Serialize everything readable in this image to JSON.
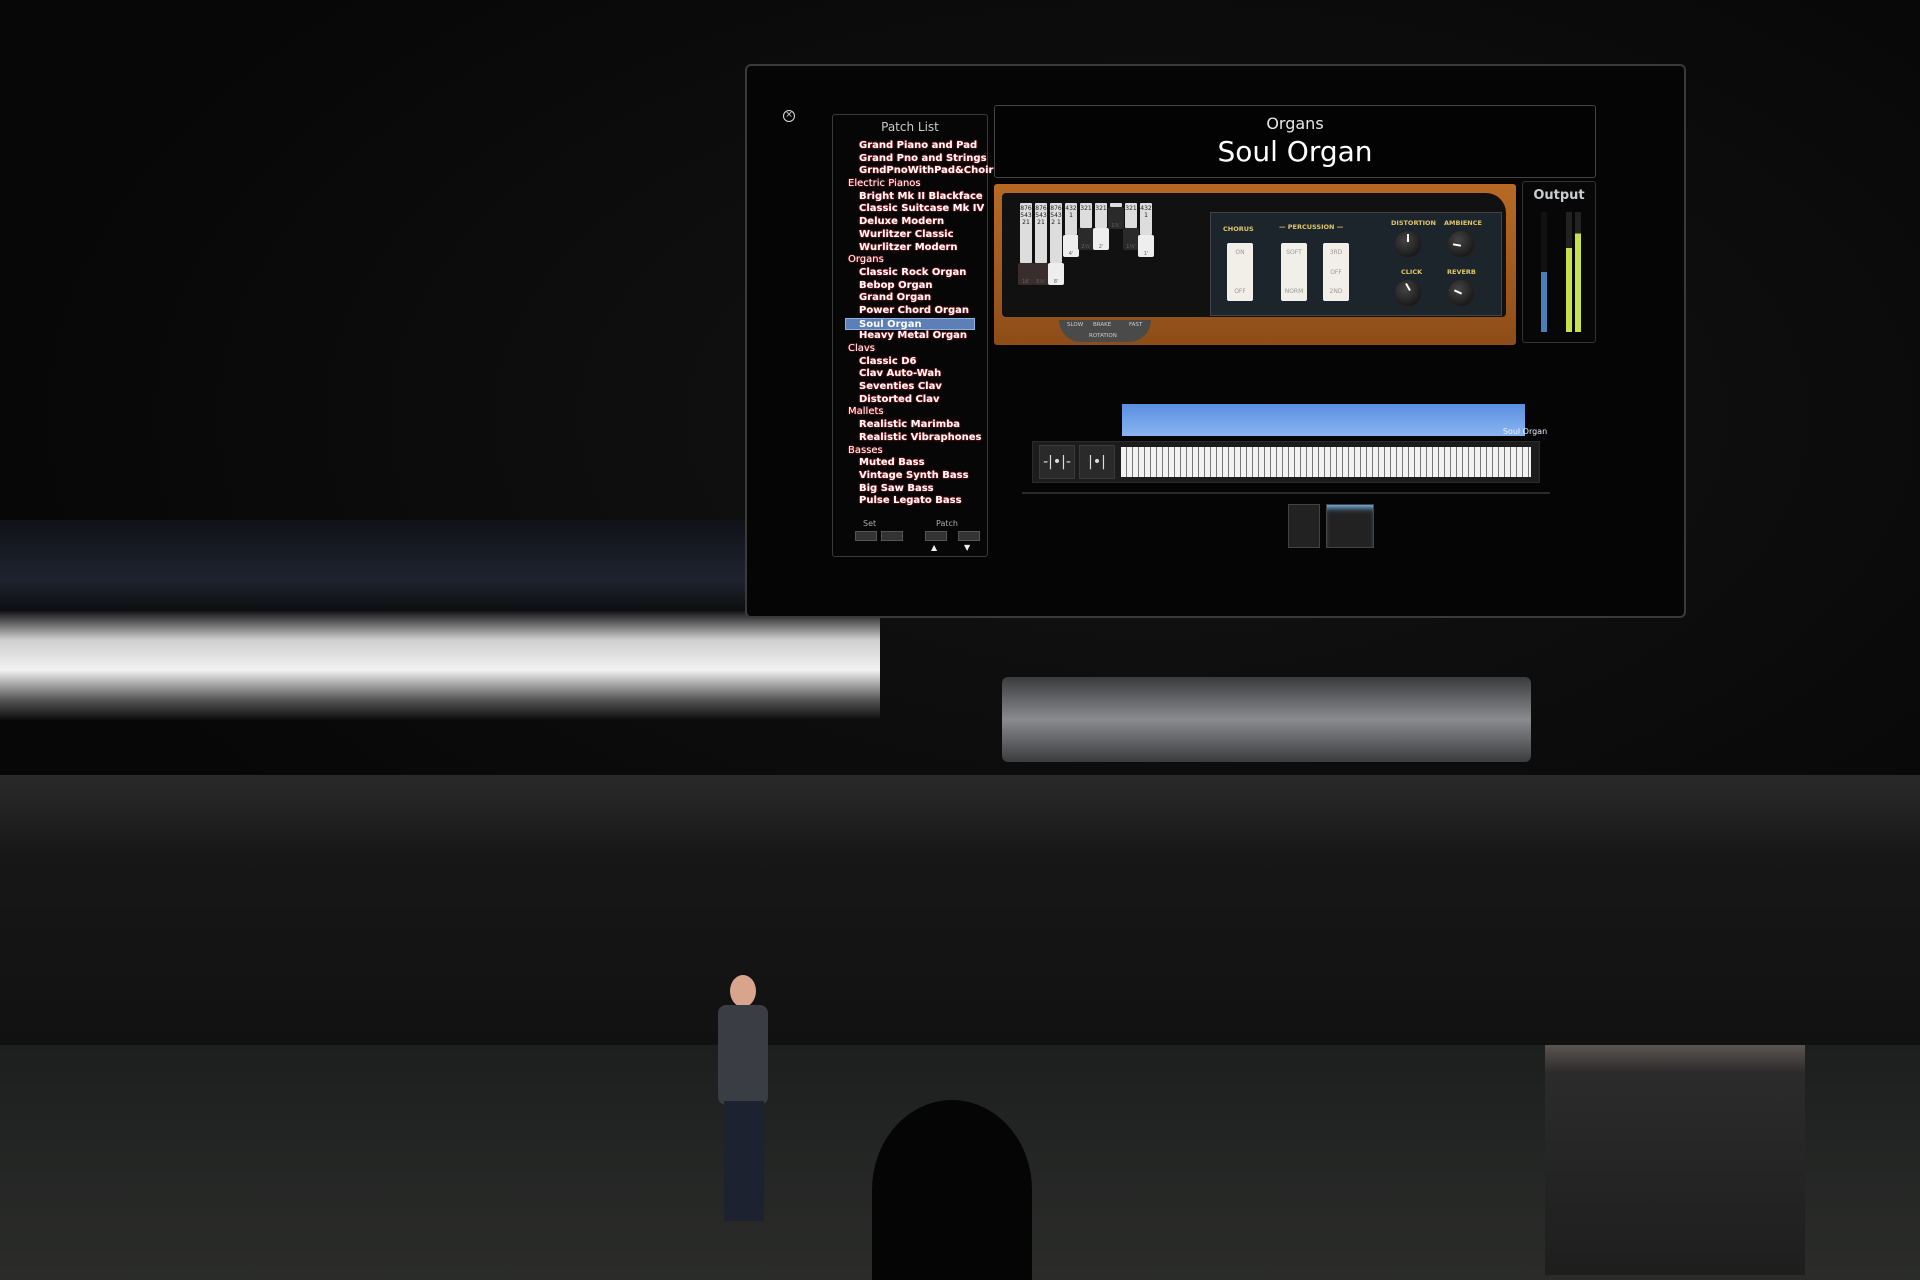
{
  "screen": {
    "close_icon": "close-circle-icon",
    "patch_list": {
      "title": "Patch List",
      "rows": [
        {
          "type": "item",
          "label": "Grand Piano and Pad"
        },
        {
          "type": "item",
          "label": "Grand Pno and Strings"
        },
        {
          "type": "item",
          "label": "GrndPnoWithPad&Choir"
        },
        {
          "type": "category",
          "label": "Electric Pianos"
        },
        {
          "type": "item",
          "label": "Bright Mk II Blackface"
        },
        {
          "type": "item",
          "label": "Classic Suitcase Mk IV"
        },
        {
          "type": "item",
          "label": "Deluxe Modern"
        },
        {
          "type": "item",
          "label": "Wurlitzer Classic"
        },
        {
          "type": "item",
          "label": "Wurlitzer Modern"
        },
        {
          "type": "category",
          "label": "Organs"
        },
        {
          "type": "item",
          "label": "Classic Rock Organ"
        },
        {
          "type": "item",
          "label": "Bebop Organ"
        },
        {
          "type": "item",
          "label": "Grand Organ"
        },
        {
          "type": "item",
          "label": "Power Chord Organ"
        },
        {
          "type": "item",
          "label": "Soul Organ",
          "selected": true
        },
        {
          "type": "item",
          "label": "Heavy Metal Organ"
        },
        {
          "type": "category",
          "label": "Clavs"
        },
        {
          "type": "item",
          "label": "Classic D6"
        },
        {
          "type": "item",
          "label": "Clav Auto-Wah"
        },
        {
          "type": "item",
          "label": "Seventies Clav"
        },
        {
          "type": "item",
          "label": "Distorted Clav"
        },
        {
          "type": "category",
          "label": "Mallets"
        },
        {
          "type": "item",
          "label": "Realistic Marimba"
        },
        {
          "type": "item",
          "label": "Realistic Vibraphones"
        },
        {
          "type": "category",
          "label": "Basses"
        },
        {
          "type": "item",
          "label": "Muted Bass"
        },
        {
          "type": "item",
          "label": "Vintage Synth Bass"
        },
        {
          "type": "item",
          "label": "Big Saw Bass"
        },
        {
          "type": "item",
          "label": "Pulse Legato Bass"
        }
      ],
      "set_label": "Set",
      "patch_label": "Patch",
      "up_arrow": "▲",
      "down_arrow": "▼"
    },
    "header": {
      "category": "Organs",
      "patch_name": "Soul Organ"
    },
    "organ": {
      "drawbars": [
        {
          "footage": "16'",
          "numbers": "87654321"
        },
        {
          "footage": "5⅓'",
          "numbers": "87654321"
        },
        {
          "footage": "8'",
          "numbers": "8765432 1"
        },
        {
          "footage": "4'",
          "numbers": "4321"
        },
        {
          "footage": "2⅔'",
          "numbers": "321"
        },
        {
          "footage": "2'",
          "numbers": "321"
        },
        {
          "footage": "1⅗'",
          "numbers": ""
        },
        {
          "footage": "1⅓'",
          "numbers": "321"
        },
        {
          "footage": "1'",
          "numbers": "4321"
        }
      ],
      "chorus_label": "CHORUS",
      "percussion_label": "— PERCUSSION —",
      "chorus_switch": {
        "top": "ON",
        "bottom": "OFF"
      },
      "volume_switch": {
        "top": "SOFT",
        "bottom": "NORM"
      },
      "harmonic_switch": {
        "top": "3RD",
        "middle": "OFF",
        "bottom": "2ND"
      },
      "knobs": [
        "DISTORTION",
        "AMBIENCE",
        "CLICK",
        "REVERB"
      ],
      "rotation": {
        "slow": "SLOW",
        "brake": "BRAKE",
        "fast": "FAST",
        "label": "ROTATION"
      }
    },
    "output": {
      "label": "Output",
      "fader_level": 0.5,
      "meter_left": 0.7,
      "meter_right": 0.82,
      "meter_color": "#c8e04a"
    },
    "layer": {
      "name": "Soul Organ",
      "color": "#6f9ee8"
    },
    "wheels": {
      "pitch": "-|•|-",
      "mod": "|•|"
    }
  }
}
